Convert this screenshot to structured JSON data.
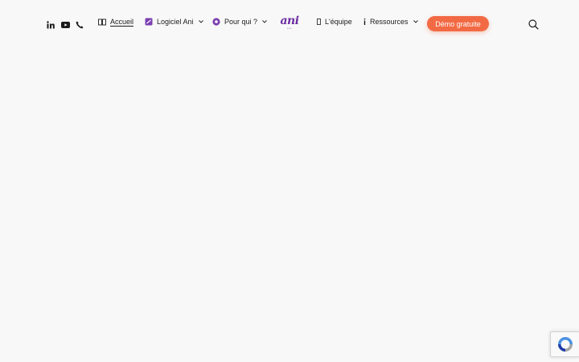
{
  "header": {
    "social": [
      {
        "icon": "linkedin-icon"
      },
      {
        "icon": "youtube-icon"
      },
      {
        "icon": "phone-icon"
      }
    ],
    "nav": {
      "accueil": {
        "label": "Accueil",
        "icon": "home-icon"
      },
      "logiciel": {
        "label": "Logiciel Ani",
        "icon": "screen-icon"
      },
      "pourqui": {
        "label": "Pour qui ?",
        "icon": "target-icon"
      },
      "equipe": {
        "label": "L'équipe",
        "icon": "team-icon"
      },
      "ressources": {
        "label": "Ressources",
        "icon": "info-icon"
      }
    },
    "logo": {
      "text": "ani"
    },
    "cta_label": "Démo gratuite",
    "search_icon": "search-icon"
  },
  "colors": {
    "accent": "#f26a44",
    "brand": "#6b2aa0",
    "background": "#f8f8f8"
  },
  "recaptcha": {
    "icon": "recaptcha-icon"
  }
}
